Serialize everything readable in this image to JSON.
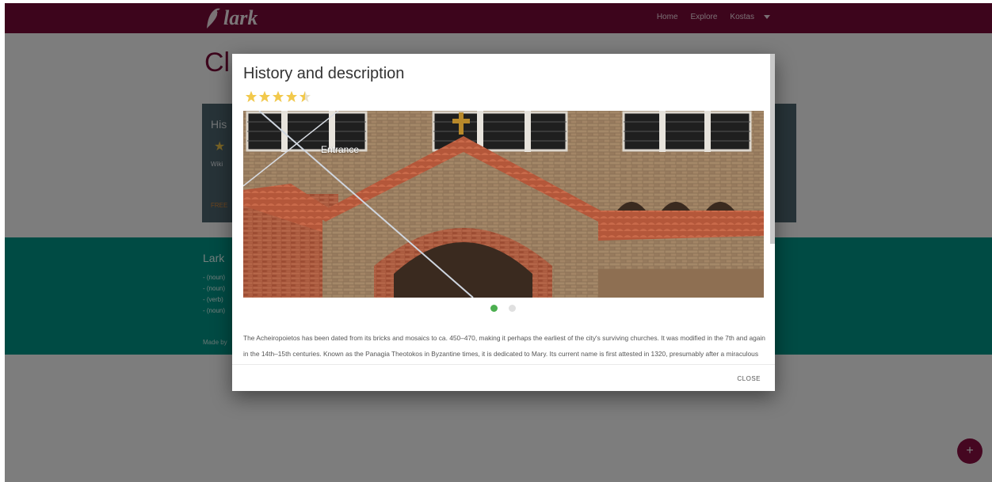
{
  "app": {
    "logo_text": "lark"
  },
  "nav": {
    "home": "Home",
    "explore": "Explore",
    "user": "Kostas"
  },
  "background": {
    "page_title": "Cl",
    "card": {
      "title": "His",
      "wiki": "Wiki",
      "free": "FREE"
    },
    "teal": {
      "title": "Lark",
      "lines": [
        "- (noun)",
        "- (noun)",
        "- (verb)",
        "- (noun)"
      ],
      "made_by": "Made by"
    },
    "fab_label": "+"
  },
  "modal": {
    "title": "History and description",
    "rating": 4.5,
    "image_caption": "Entrance",
    "slide_index": 0,
    "slide_count": 2,
    "description": "The Acheiropoietos has been dated from its bricks and mosaics to ca. 450–470, making it perhaps the earliest of the city's surviving churches. It was modified in the 7th and again in the 14th–15th centuries. Known as the Panagia Theotokos in Byzantine times, it is dedicated to Mary. Its current name is first attested in 1320, presumably after a miraculous acheiropoietos (\"not made by hands\") icon of Panagia Hodegetria that was housed there. Byzantine sources also indicate that the cult of the city's",
    "close_label": "CLOSE"
  },
  "colors": {
    "brand": "#7a0a39",
    "teal": "#009688",
    "card": "#4f6671",
    "dot_active": "#4caf50",
    "star": "#f2c94c"
  }
}
